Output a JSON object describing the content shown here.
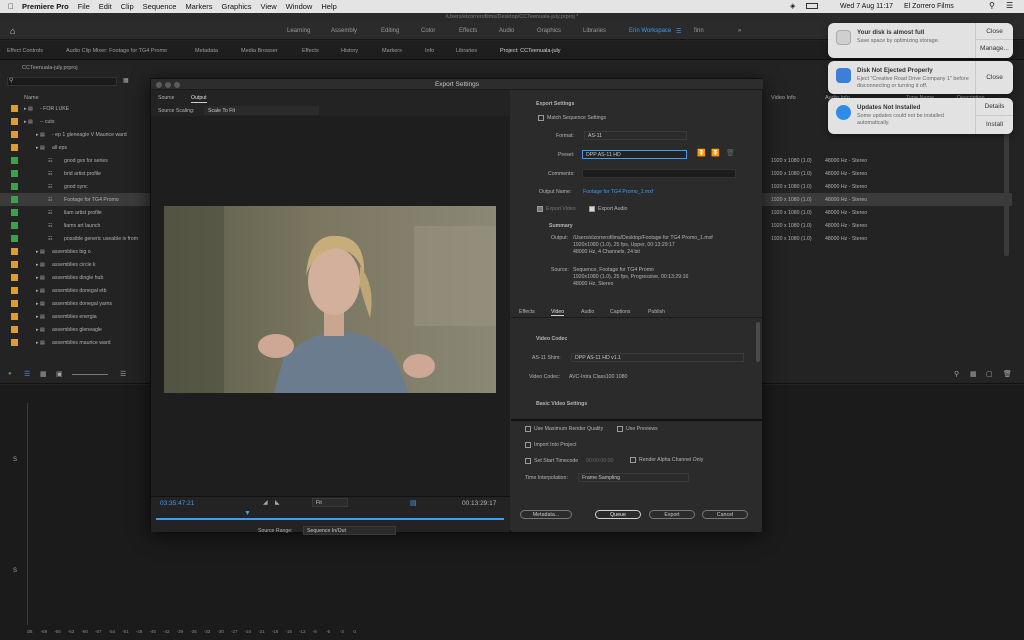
{
  "menubar": {
    "app": "Premiere Pro",
    "items": [
      "File",
      "Edit",
      "Clip",
      "Sequence",
      "Markers",
      "Graphics",
      "View",
      "Window",
      "Help"
    ],
    "datetime": "Wed 7 Aug  11:17",
    "user": "El Zorrero Films"
  },
  "window": {
    "title": "/Users/elzorrerofilms/Desktop/CCTeenuala-july.prproj *"
  },
  "workspaces": {
    "tabs": [
      "Learning",
      "Assembly",
      "Editing",
      "Color",
      "Effects",
      "Audio",
      "Graphics",
      "Libraries",
      "Erin Workspace",
      "finn"
    ],
    "active": "Erin Workspace"
  },
  "panels": {
    "tabs": [
      "Effect Controls",
      "Audio Clip Mixer: Footage for TG4 Promo",
      "Metadata",
      "Media Browser",
      "Effects",
      "History",
      "Markers",
      "Info",
      "Libraries",
      "Project: CCTeenuala-july"
    ]
  },
  "project": {
    "file": "CCTeenuala-july.prproj",
    "col_name": "Name",
    "col_video": "Video Info",
    "col_audio": "Audio Info",
    "col_type": "Type Name",
    "col_desc": "Description",
    "rows": [
      {
        "name": "- FOR LUKE",
        "color": "o",
        "indent": 1,
        "video": "",
        "audio": ""
      },
      {
        "name": "-- cuts",
        "color": "o",
        "indent": 1,
        "video": "",
        "audio": ""
      },
      {
        "name": "- ep 1 gleneagle V Maurice ward",
        "color": "o",
        "indent": 2,
        "video": "",
        "audio": ""
      },
      {
        "name": "all eps",
        "color": "o",
        "indent": 2,
        "video": "",
        "audio": ""
      },
      {
        "name": "good gvs for series",
        "color": "g",
        "indent": 3,
        "video": "1920 x 1080 (1.0)",
        "audio": "48000 Hz - Stereo"
      },
      {
        "name": "brid artist profile",
        "color": "g",
        "indent": 3,
        "video": "1920 x 1080 (1.0)",
        "audio": "48000 Hz - Stereo"
      },
      {
        "name": "good sync",
        "color": "g",
        "indent": 3,
        "video": "1920 x 1080 (1.0)",
        "audio": "48000 Hz - Stereo"
      },
      {
        "name": "Footage for TG4 Promo",
        "color": "g",
        "indent": 3,
        "video": "1920 x 1080 (1.0)",
        "audio": "48000 Hz - Stereo",
        "selected": true
      },
      {
        "name": "liam artist profile",
        "color": "g",
        "indent": 3,
        "video": "1920 x 1080 (1.0)",
        "audio": "48000 Hz - Stereo"
      },
      {
        "name": "liams art launch",
        "color": "g",
        "indent": 3,
        "video": "1920 x 1080 (1.0)",
        "audio": "48000 Hz - Stereo"
      },
      {
        "name": "possible generic useable iv from",
        "color": "g",
        "indent": 3,
        "video": "1920 x 1080 (1.0)",
        "audio": "48000 Hz - Stereo"
      },
      {
        "name": "assemblies big o",
        "color": "o",
        "indent": 2,
        "video": "",
        "audio": ""
      },
      {
        "name": "assemblies circle k",
        "color": "o",
        "indent": 2,
        "video": "",
        "audio": ""
      },
      {
        "name": "assemblies dingle hub",
        "color": "o",
        "indent": 2,
        "video": "",
        "audio": ""
      },
      {
        "name": "assemblies donegal etb",
        "color": "o",
        "indent": 2,
        "video": "",
        "audio": ""
      },
      {
        "name": "assemblies donegal yarns",
        "color": "o",
        "indent": 2,
        "video": "",
        "audio": ""
      },
      {
        "name": "assemblies energia",
        "color": "o",
        "indent": 2,
        "video": "",
        "audio": ""
      },
      {
        "name": "assemblies gleneagle",
        "color": "o",
        "indent": 2,
        "video": "",
        "audio": ""
      },
      {
        "name": "assemblies maurice ward",
        "color": "o",
        "indent": 2,
        "video": "",
        "audio": ""
      }
    ]
  },
  "export_dialog": {
    "title": "Export Settings",
    "tabs": [
      "Source",
      "Output"
    ],
    "source_scaling_label": "Source Scaling:",
    "source_scaling_value": "Scale To Fit",
    "timecode_in": "03:35:47:21",
    "timecode_out": "00:13:29:17",
    "fit": "Fit",
    "source_range_label": "Source Range:",
    "source_range_value": "Sequence In/Out",
    "export_settings_header": "Export Settings",
    "match_sequence": "Match Sequence Settings",
    "format_label": "Format:",
    "format_value": "AS-11",
    "preset_label": "Preset:",
    "preset_value": "DPP AS-11 HD",
    "comments_label": "Comments:",
    "output_name_label": "Output Name:",
    "output_name_value": "Footage for TG4 Promo_1.mxf",
    "export_video": "Export Video",
    "export_audio": "Export Audio",
    "summary_header": "Summary",
    "summary_output_label": "Output:",
    "summary_output_lines": [
      "/Users/elzorrerofilms/Desktop/Footage for TG4 Promo_1.mxf",
      "1920x1080 (1.0), 25 fps, Upper, 00:13:29:17",
      "48000 Hz, 4 Channels, 24 bit"
    ],
    "summary_source_label": "Source:",
    "summary_source_lines": [
      "Sequence, Footage for TG4 Promo",
      "1920x1080 (1.0), 25 fps, Progressive, 00:13:29:16",
      "48000 Hz, Stereo"
    ],
    "subtabs": [
      "Effects",
      "Video",
      "Audio",
      "Captions",
      "Publish"
    ],
    "active_subtab": "Video",
    "video_codec_header": "Video Codec",
    "shim_label": "AS-11 Shim:",
    "shim_value": "DPP AS-11 HD v1.1",
    "codec_label": "Video Codec:",
    "codec_value": "AVC-Intra Class100 1080",
    "basic_video_header": "Basic Video Settings",
    "use_max_quality": "Use Maximum Render Quality",
    "use_previews": "Use Previews",
    "import_into_project": "Import Into Project",
    "set_start_timecode": "Set Start Timecode",
    "start_timecode_value": "00:00:00:00",
    "render_alpha": "Render Alpha Channel Only",
    "time_interp_label": "Time Interpolation:",
    "time_interp_value": "Frame Sampling",
    "btn_metadata": "Metadata...",
    "btn_queue": "Queue",
    "btn_export": "Export",
    "btn_cancel": "Cancel"
  },
  "notifications": [
    {
      "title": "Your disk is almost full",
      "body": "Save space by optimizing storage.",
      "buttons": [
        "Close",
        "Manage..."
      ],
      "icon_color": "#bfbfbf"
    },
    {
      "title": "Disk Not Ejected Properly",
      "body": "Eject \"Creative Road Drive Company 1\" before disconnecting or turning it off.",
      "buttons": [
        "Close"
      ],
      "icon_color": "#3d7ed8"
    },
    {
      "title": "Updates Not Installed",
      "body": "Some updates could not be installed automatically.",
      "buttons": [
        "Details",
        "Install"
      ],
      "icon_color": "#2e8be8"
    }
  ],
  "meter": {
    "scale": [
      "dB",
      "-69",
      "-66",
      "-63",
      "-60",
      "-57",
      "-54",
      "-51",
      "-48",
      "-45",
      "-42",
      "-39",
      "-36",
      "-33",
      "-30",
      "-27",
      "-24",
      "-21",
      "-18",
      "-15",
      "-12",
      "-9",
      "-6",
      "-3",
      "0"
    ],
    "channel_labels": [
      "S",
      "S"
    ]
  }
}
